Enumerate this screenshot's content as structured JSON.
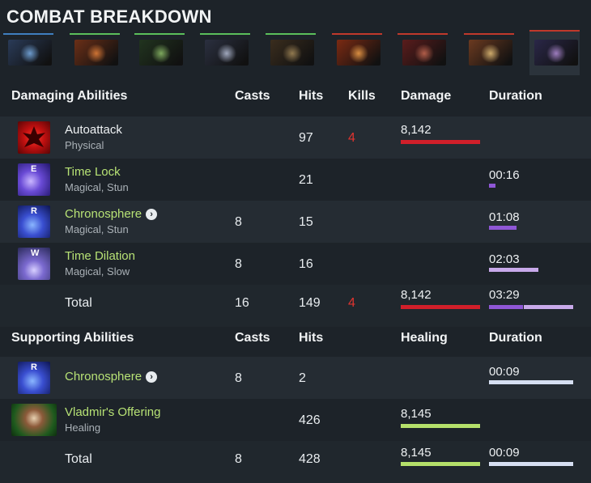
{
  "title": "COMBAT BREAKDOWN",
  "heroes": [
    {
      "icon": "void-spirit-portrait-icon",
      "bar_color": "#3f7fbf",
      "bg": "#2a3b58",
      "glow": "#7bb0e8"
    },
    {
      "icon": "phoenix-portrait-icon",
      "bar_color": "#5bbf5b",
      "bg": "#6b2f17",
      "glow": "#e8823a"
    },
    {
      "icon": "pugna-portrait-icon",
      "bar_color": "#5bbf5b",
      "bg": "#21341f",
      "glow": "#8fc06a"
    },
    {
      "icon": "night-stalker-portrait-icon",
      "bar_color": "#5bbf5b",
      "bg": "#2b3040",
      "glow": "#b7c0d8"
    },
    {
      "icon": "tiny-portrait-icon",
      "bar_color": "#5bbf5b",
      "bg": "#3a2d1e",
      "glow": "#a58a5a"
    },
    {
      "icon": "lina-portrait-icon",
      "bar_color": "#c0392b",
      "bg": "#7b2a12",
      "glow": "#f3a24a"
    },
    {
      "icon": "bloodseeker-portrait-icon",
      "bar_color": "#c0392b",
      "bg": "#5a1c1c",
      "glow": "#c76a52"
    },
    {
      "icon": "juggernaut-portrait-icon",
      "bar_color": "#c0392b",
      "bg": "#6b3a20",
      "glow": "#e7c27a"
    },
    {
      "icon": "faceless-void-portrait-icon",
      "bar_color": "#c0392b",
      "bg": "#2a2748",
      "glow": "#b48ed8",
      "selected": true
    }
  ],
  "damaging": {
    "header": {
      "label": "Damaging Abilities",
      "casts": "Casts",
      "hits": "Hits",
      "kills": "Kills",
      "damage": "Damage",
      "duration": "Duration"
    },
    "rows": [
      {
        "icon": "autoattack-icon",
        "hotkey": "",
        "name": "Autoattack",
        "type": "Physical",
        "casts": "",
        "hits": "97",
        "kills": "4",
        "damage": "8,142",
        "damage_frac": 1.0,
        "duration": "",
        "is_ability": false
      },
      {
        "icon": "time-lock-icon",
        "hotkey": "E",
        "name": "Time Lock",
        "type": "Magical, Stun",
        "casts": "",
        "hits": "21",
        "kills": "",
        "damage": "",
        "damage_frac": 0,
        "duration": "00:16",
        "duration_frac": 0.08,
        "is_ability": true
      },
      {
        "icon": "chronosphere-icon",
        "hotkey": "R",
        "name": "Chronosphere",
        "type": "Magical, Stun",
        "casts": "8",
        "hits": "15",
        "kills": "",
        "damage": "",
        "damage_frac": 0,
        "duration": "01:08",
        "duration_frac": 0.33,
        "is_ability": true,
        "expand": true
      },
      {
        "icon": "time-dilation-icon",
        "hotkey": "W",
        "name": "Time Dilation",
        "type": "Magical, Slow",
        "casts": "8",
        "hits": "16",
        "kills": "",
        "damage": "",
        "damage_frac": 0,
        "duration": "02:03",
        "duration_frac": 0.59,
        "is_ability": true
      }
    ],
    "total": {
      "label": "Total",
      "casts": "16",
      "hits": "149",
      "kills": "4",
      "damage": "8,142",
      "damage_frac": 1.0,
      "duration": "03:29",
      "duration_parts": [
        0.08,
        0.33,
        0.59
      ]
    }
  },
  "supporting": {
    "header": {
      "label": "Supporting Abilities",
      "casts": "Casts",
      "hits": "Hits",
      "healing": "Healing",
      "duration": "Duration"
    },
    "rows": [
      {
        "icon": "chronosphere-icon",
        "hotkey": "R",
        "name": "Chronosphere",
        "type": "",
        "casts": "8",
        "hits": "2",
        "healing": "",
        "healing_frac": 0,
        "duration": "00:09",
        "duration_frac": 1.0,
        "is_ability": true,
        "expand": true
      },
      {
        "icon": "vladmirs-offering-icon",
        "hotkey": "",
        "name": "Vladmir's Offering",
        "type": "Healing",
        "casts": "",
        "hits": "426",
        "healing": "8,145",
        "healing_frac": 1.0,
        "duration": "",
        "duration_frac": 0,
        "is_ability": true
      }
    ],
    "total": {
      "label": "Total",
      "casts": "8",
      "hits": "428",
      "healing": "8,145",
      "healing_frac": 1.0,
      "duration": "00:09",
      "duration_frac": 1.0
    }
  },
  "colors": {
    "damage": "#d11f2a",
    "magic_dur": "#8f57d6",
    "magic_dur_light": "#c8a9ea",
    "support_dur": "#d6dff2",
    "healing": "#b5e06a",
    "ability_text": "#b7e275"
  }
}
